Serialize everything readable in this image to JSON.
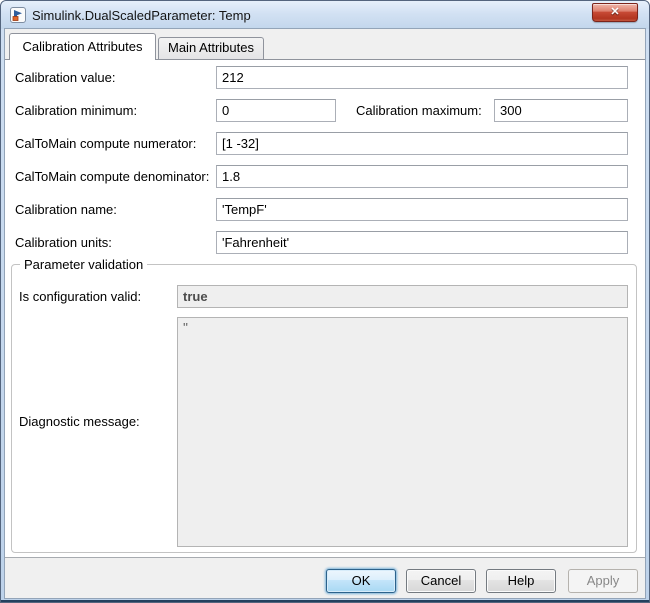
{
  "window": {
    "title": "Simulink.DualScaledParameter: Temp"
  },
  "icons": {
    "app": "simulink-logo",
    "close_glyph": "✕"
  },
  "tabs": [
    {
      "label": "Calibration Attributes",
      "active": true
    },
    {
      "label": "Main Attributes",
      "active": false
    }
  ],
  "fields": {
    "calibration_value": {
      "label": "Calibration value:",
      "value": "212"
    },
    "calibration_minimum": {
      "label": "Calibration minimum:",
      "value": "0"
    },
    "calibration_maximum": {
      "label": "Calibration maximum:",
      "value": "300"
    },
    "caltomain_numerator": {
      "label": "CalToMain compute numerator:",
      "value": "[1 -32]"
    },
    "caltomain_denominator": {
      "label": "CalToMain compute denominator:",
      "value": "1.8"
    },
    "calibration_name": {
      "label": "Calibration name:",
      "value": "'TempF'"
    },
    "calibration_units": {
      "label": "Calibration units:",
      "value": "'Fahrenheit'"
    }
  },
  "validation": {
    "group_title": "Parameter validation",
    "is_configuration_valid": {
      "label": "Is configuration valid:",
      "value": "true",
      "readonly": true
    },
    "diagnostic_message": {
      "label": "Diagnostic message:",
      "value": "''",
      "readonly": true
    }
  },
  "footer": {
    "ok": {
      "label": "OK",
      "state": "focused"
    },
    "cancel": {
      "label": "Cancel",
      "state": "normal"
    },
    "help": {
      "label": "Help",
      "state": "normal"
    },
    "apply": {
      "label": "Apply",
      "state": "disabled"
    }
  },
  "colors": {
    "titlebar_top": "#e6f0fb",
    "titlebar_bottom": "#c2d6ec",
    "window_border_blue": "#bdd2ea",
    "close_button_red": "#c1452f",
    "focus_button_blue": "#a8d8f3",
    "focus_border_blue": "#2c628b",
    "disabled_field_bg": "#efefef",
    "footer_bg": "#f0f0f0"
  }
}
